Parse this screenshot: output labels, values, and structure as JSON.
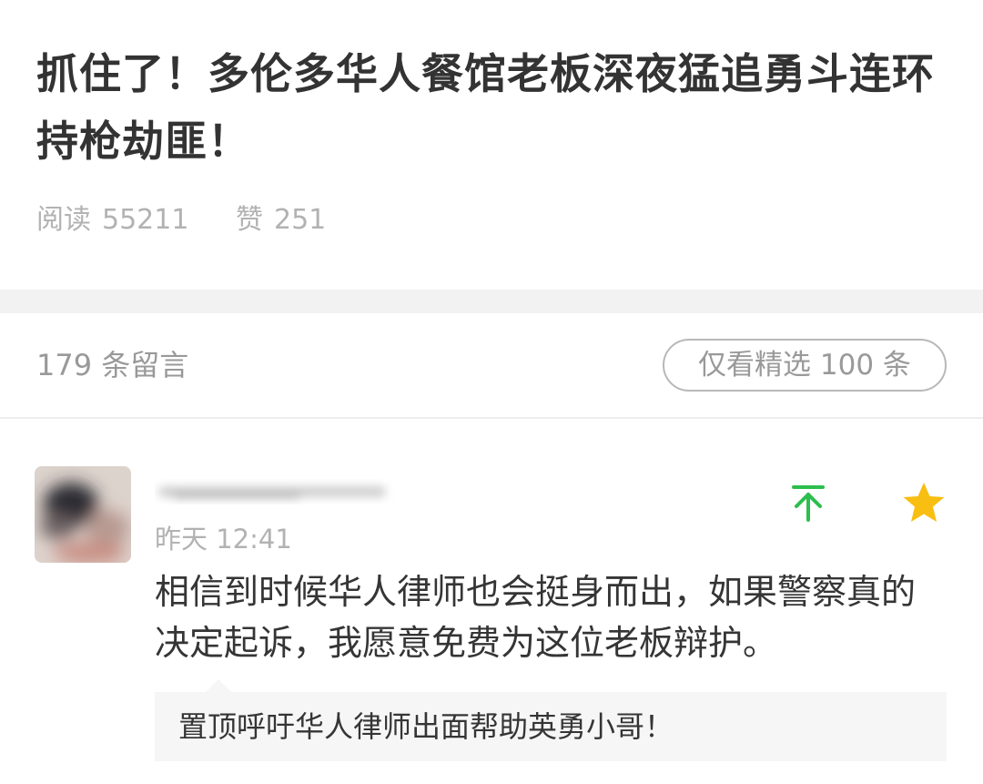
{
  "article": {
    "title": "抓住了！多伦多华人餐馆老板深夜猛追勇斗连环持枪劫匪！",
    "read_label": "阅读",
    "read_count": "55211",
    "like_label": "赞",
    "like_count": "251"
  },
  "comments_section": {
    "count_text": "179 条留言",
    "filter_button_label": "仅看精选 100 条"
  },
  "comment": {
    "avatar_icon": "blurred-avatar",
    "time": "昨天 12:41",
    "text": "相信到时候华人律师也会挺身而出，如果警察真的决定起诉，我愿意免费为这位老板辩护。",
    "pin_icon": "arrow-to-top-icon",
    "star_icon": "star-icon",
    "reply": "置顶呼吁华人律师出面帮助英勇小哥！"
  },
  "colors": {
    "pin_green": "#2dbe4d",
    "star_yellow": "#f8be12",
    "muted_text": "#b2b2b2",
    "body_text": "#353535"
  }
}
